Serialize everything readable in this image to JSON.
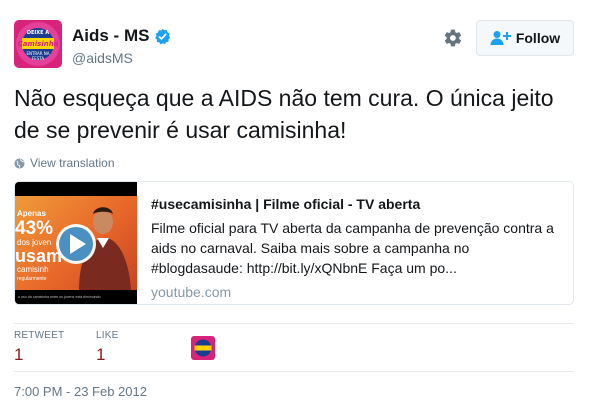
{
  "user": {
    "name": "Aids - MS",
    "handle": "@aidsMS",
    "avatar_text": "DEIXE A CAMISINHA ENTRAR NA FESTA"
  },
  "follow_button": {
    "label": "Follow"
  },
  "tweet": {
    "text": "Não esqueça que a AIDS não tem cura. O única jeito de se prevenir é usar camisinha!",
    "translate_label": "View translation",
    "timestamp": "7:00 PM - 23 Feb 2012"
  },
  "card": {
    "title": "#usecamisinha | Filme oficial - TV aberta",
    "description": "Filme oficial para TV aberta da campanha de prevenção contra a aids no carnaval. Saiba mais sobre a campanha no #blogdasaude: http://bit.ly/xQNbnE Faça um po...",
    "domain": "youtube.com",
    "thumb_text": {
      "line1": "Apenas",
      "line2": "43%",
      "line3": "dos joven",
      "line4": "usam",
      "line5": "camisinh",
      "line6": "regularmente",
      "caption": "o uso da camisinha entre os jovens está diminuindo"
    }
  },
  "stats": {
    "retweet_label": "RETWEET",
    "retweet_count": "1",
    "like_label": "LIKE",
    "like_count": "1"
  },
  "icons": [
    "verified-icon",
    "gear-icon",
    "follow-person-icon",
    "globe-icon",
    "play-icon"
  ],
  "colors": {
    "verified": "#1da1f2",
    "brand_pink": "#e0287f",
    "count": "#8b1a1a",
    "muted": "#657786"
  }
}
